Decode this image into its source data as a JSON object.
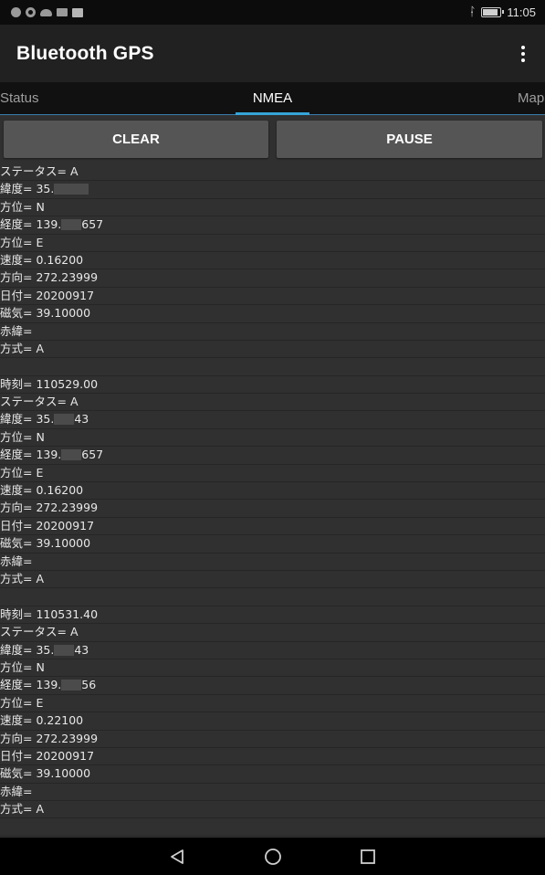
{
  "status_bar": {
    "time": "11:05",
    "battery_level": 0.9,
    "icons": [
      "circle-icon",
      "target-icon",
      "cloud-icon",
      "app-icon",
      "mail-icon"
    ],
    "right_icons": [
      "bluetooth-icon",
      "battery-icon"
    ]
  },
  "app": {
    "title": "Bluetooth GPS",
    "menu_icon": "overflow-menu-icon"
  },
  "tabs": [
    {
      "label": "Status",
      "selected": false
    },
    {
      "label": "NMEA",
      "selected": true
    },
    {
      "label": "Map",
      "selected": false
    }
  ],
  "actions": {
    "clear_label": "CLEAR",
    "pause_label": "PAUSE"
  },
  "log_rows": [
    {
      "pre": "ステータス= A"
    },
    {
      "pre": "緯度= 35.",
      "masked": true,
      "post": ""
    },
    {
      "pre": "方位= N"
    },
    {
      "pre": "経度= 139.",
      "masked": true,
      "post": "657"
    },
    {
      "pre": "方位= E"
    },
    {
      "pre": "速度= 0.16200"
    },
    {
      "pre": "方向= 272.23999"
    },
    {
      "pre": "日付= 20200917"
    },
    {
      "pre": "磁気= 39.10000"
    },
    {
      "pre": "赤緯="
    },
    {
      "pre": "方式= A"
    },
    {
      "pre": ""
    },
    {
      "pre": "時刻= 110529.00"
    },
    {
      "pre": "ステータス= A"
    },
    {
      "pre": "緯度= 35.",
      "masked": true,
      "post": "43"
    },
    {
      "pre": "方位= N"
    },
    {
      "pre": "経度= 139.",
      "masked": true,
      "post": "657"
    },
    {
      "pre": "方位= E"
    },
    {
      "pre": "速度= 0.16200"
    },
    {
      "pre": "方向= 272.23999"
    },
    {
      "pre": "日付= 20200917"
    },
    {
      "pre": "磁気= 39.10000"
    },
    {
      "pre": "赤緯="
    },
    {
      "pre": "方式= A"
    },
    {
      "pre": ""
    },
    {
      "pre": "時刻= 110531.40"
    },
    {
      "pre": "ステータス= A"
    },
    {
      "pre": "緯度= 35.",
      "masked": true,
      "post": "43"
    },
    {
      "pre": "方位= N"
    },
    {
      "pre": "経度= 139.",
      "masked": true,
      "post": "56"
    },
    {
      "pre": "方位= E"
    },
    {
      "pre": "速度= 0.22100"
    },
    {
      "pre": "方向= 272.23999"
    },
    {
      "pre": "日付= 20200917"
    },
    {
      "pre": "磁気= 39.10000"
    },
    {
      "pre": "赤緯="
    },
    {
      "pre": "方式= A"
    },
    {
      "pre": ""
    }
  ],
  "nav": {
    "back_icon": "back-triangle-icon",
    "home_icon": "home-circle-icon",
    "recents_icon": "recents-square-icon"
  }
}
